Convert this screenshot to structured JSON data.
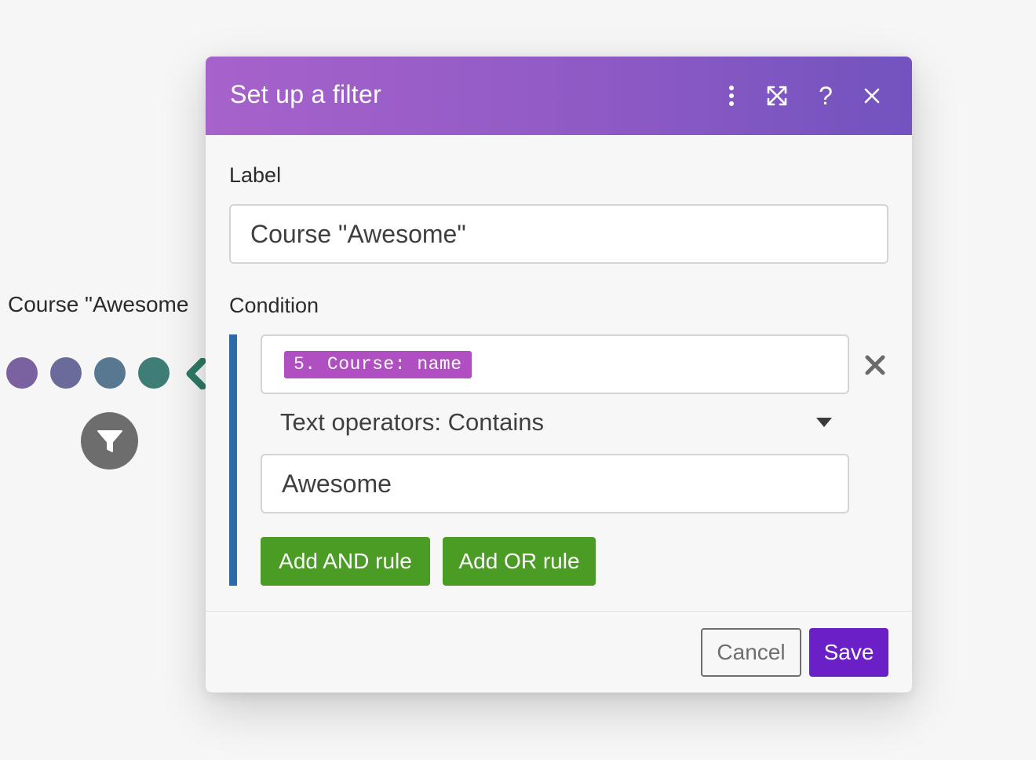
{
  "canvas": {
    "route_label": "Course \"Awesome",
    "dots": [
      "#7a61a0",
      "#6a6b9a",
      "#577890",
      "#3f7e76"
    ],
    "chevron_color": "#2e7a66",
    "filter_node_icon": "filter-funnel-icon"
  },
  "dialog": {
    "title": "Set up a filter",
    "header_actions": [
      "more-vertical-icon",
      "expand-icon",
      "help-icon",
      "close-icon"
    ],
    "help_glyph": "?",
    "label_field": {
      "label": "Label",
      "value": "Course \"Awesome\""
    },
    "condition": {
      "label": "Condition",
      "operand_token": "5. Course: name",
      "operator": "Text operators: Contains",
      "value": "Awesome"
    },
    "rule_buttons": {
      "add_and": "Add AND rule",
      "add_or": "Add OR rule"
    },
    "footer": {
      "cancel": "Cancel",
      "save": "Save"
    }
  },
  "colors": {
    "header_gradient_start": "#a762cb",
    "header_gradient_end": "#7253bf",
    "token_bg": "#b04fc1",
    "condition_bar": "#2c6aa8",
    "rule_button_green": "#4a9c25",
    "save_purple": "#6a1fc7"
  }
}
